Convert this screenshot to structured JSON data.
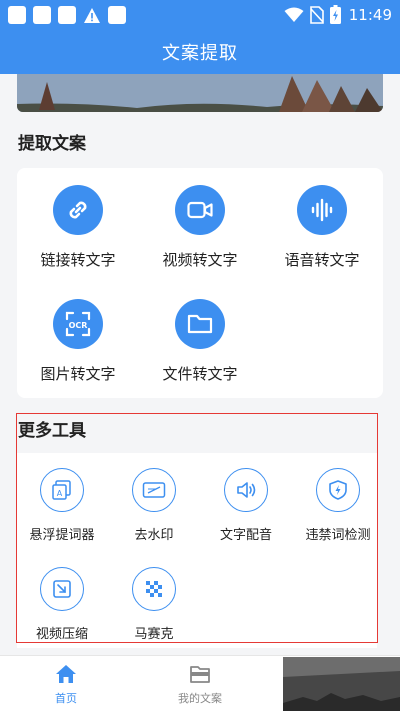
{
  "status_bar": {
    "time": "11:49"
  },
  "app_bar": {
    "title": "文案提取"
  },
  "extract_section": {
    "title": "提取文案",
    "items": [
      {
        "label": "链接转文字",
        "icon": "link-icon"
      },
      {
        "label": "视频转文字",
        "icon": "video-camera-icon"
      },
      {
        "label": "语音转文字",
        "icon": "voice-wave-icon"
      },
      {
        "label": "图片转文字",
        "icon": "ocr-scan-icon"
      },
      {
        "label": "文件转文字",
        "icon": "folder-icon"
      }
    ]
  },
  "tools_section": {
    "title": "更多工具",
    "items": [
      {
        "label": "悬浮提词器",
        "icon": "teleprompter-icon"
      },
      {
        "label": "去水印",
        "icon": "watermark-remove-icon"
      },
      {
        "label": "文字配音",
        "icon": "speaker-icon"
      },
      {
        "label": "违禁词检测",
        "icon": "shield-lightning-icon"
      },
      {
        "label": "视频压缩",
        "icon": "compress-icon"
      },
      {
        "label": "马赛克",
        "icon": "mosaic-icon"
      }
    ]
  },
  "bottom_nav": {
    "items": [
      {
        "label": "首页",
        "icon": "home-icon",
        "active": true
      },
      {
        "label": "我的文案",
        "icon": "folder-tray-icon",
        "active": false
      }
    ]
  },
  "colors": {
    "primary": "#3d8ff0",
    "highlight": "#e53935",
    "inactive": "#888888"
  }
}
